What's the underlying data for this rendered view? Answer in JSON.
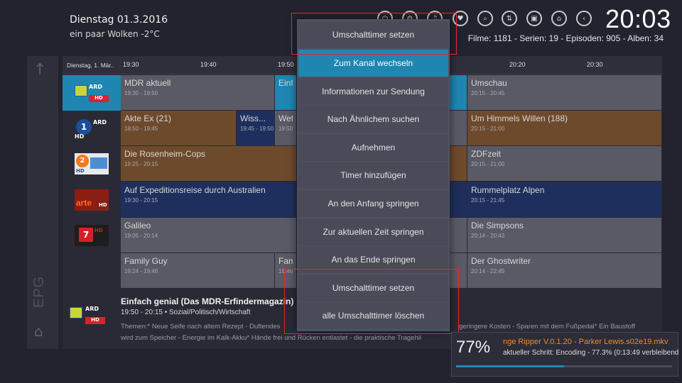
{
  "header": {
    "date": "Dienstag  01.3.2016",
    "weather": "ein paar Wolken  -2°C",
    "clock": "20:03",
    "library_stats": "Filme: 1181 - Serien: 19 - Episoden: 905 - Alben: 34"
  },
  "sidebar": {
    "label": "EPG"
  },
  "epg": {
    "header_date": "Dienstag, 1. Mär..",
    "times": [
      "19:30",
      "19:40",
      "19:50",
      "20:20",
      "20:30"
    ],
    "rows": [
      {
        "channel": "ARD MDR",
        "programs": [
          {
            "title": "MDR aktuell",
            "time": "19:30 - 19:50"
          },
          {
            "title": "Einfa",
            "time": ""
          },
          {
            "title": "Umschau",
            "time": "20:15 - 20:45"
          }
        ]
      },
      {
        "channel": "ARD HD",
        "programs": [
          {
            "title": "Akte Ex (21)",
            "time": "18:50 - 19:45"
          },
          {
            "title": "Wiss...",
            "time": "19:45 - 19:50"
          },
          {
            "title": "Wett",
            "time": "19:50"
          },
          {
            "title": "Um Himmels Willen (188)",
            "time": "20:15 - 21:00"
          }
        ]
      },
      {
        "channel": "ZDF HD",
        "programs": [
          {
            "title": "Die Rosenheim-Cops",
            "time": "19:25 - 20:15"
          },
          {
            "title": "ZDFzeit",
            "time": "20:15 - 21:00"
          }
        ]
      },
      {
        "channel": "arte HD",
        "programs": [
          {
            "title": "Auf Expeditionsreise durch Australien",
            "time": "19:30 - 20:15"
          },
          {
            "title": "Rummelplatz Alpen",
            "time": "20:15 - 21:45"
          }
        ]
      },
      {
        "channel": "ProSieben",
        "programs": [
          {
            "title": "Galileo",
            "time": "19:05 - 20:14"
          },
          {
            "title": "Die Simpsons",
            "time": "20:14 - 20:43"
          }
        ]
      },
      {
        "channel": "",
        "programs": [
          {
            "title": "Family Guy",
            "time": "19:24 - 19:46"
          },
          {
            "title": "Fami",
            "time": "19:46"
          },
          {
            "title": "Der Ghostwriter",
            "time": "20:14 - 22:45"
          }
        ]
      }
    ]
  },
  "info": {
    "title": "Einfach genial (Das MDR-Erfindermagazin)",
    "subtitle": "19:50 - 20:15 • Sozial/Politisch/Wirtschaft",
    "description_line1": "Themen:* Neue Seife nach altem Rezept - Duftendes",
    "description_line1_end": "geringere Kosten - Sparen mit dem Fußpedal* Ein Baustoff",
    "description_line2": "wird zum Speicher - Energie im Kalk-Akku* Hände frei und Rücken entlastet - die praktische Tragehil"
  },
  "menu": {
    "items": [
      "Umschalttimer setzen",
      "Zum Kanal wechseln",
      "Informationen zur Sendung",
      "Nach Ähnlichem suchen",
      "Aufnehmen",
      "Timer hinzufügen",
      "An den Anfang springen",
      "Zur aktuellen Zeit springen",
      "An das Ende springen",
      "Umschalttimer setzen",
      "alle Umschalttimer löschen"
    ]
  },
  "notification": {
    "percent": "77%",
    "title": "nge Ripper V.0.1.20 - Parker Lewis.s02e19.mkv",
    "step": "aktueller Schritt: Encoding - 77.3% (0:13:49 verbleibend",
    "progress": 0.5
  },
  "colors": {
    "accent": "#1f86b1",
    "highlight": "#e6262a",
    "brown": "#6e4a2c",
    "blue": "#1e2f5e",
    "cyan": "#1f86b1",
    "gray": "#5a5a66"
  }
}
